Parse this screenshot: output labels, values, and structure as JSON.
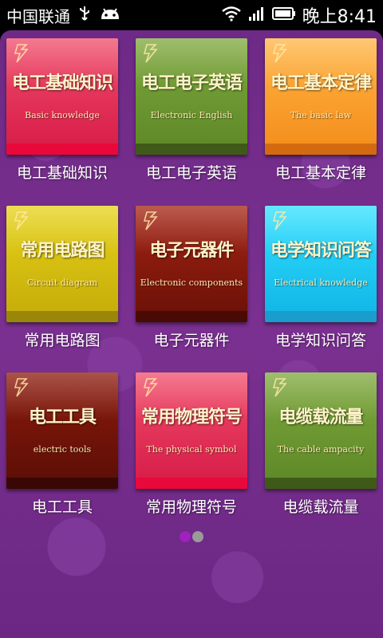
{
  "status_bar": {
    "carrier": "中国联通",
    "time": "晚上8:41",
    "icons": [
      "usb-icon",
      "android-icon",
      "wifi-icon",
      "signal-icon",
      "battery-icon"
    ]
  },
  "tiles": [
    {
      "title_zh": "电工基础知识",
      "title_en": "Basic knowledge",
      "caption": "电工基础知识",
      "color_top": "#f04d6b",
      "color_bottom": "#d81f4a",
      "base": "#e8083a"
    },
    {
      "title_zh": "电工电子英语",
      "title_en": "Electronic English",
      "caption": "电工电子英语",
      "color_top": "#7ea83d",
      "color_bottom": "#5f8a28",
      "base": "#3f5a18"
    },
    {
      "title_zh": "电工基本定律",
      "title_en": "The basic law",
      "caption": "电工基本定律",
      "color_top": "#ffb545",
      "color_bottom": "#f5901e",
      "base": "#d46a10"
    },
    {
      "title_zh": "常用电路图",
      "title_en": "Circuit diagram",
      "caption": "常用电路图",
      "color_top": "#e6d21a",
      "color_bottom": "#c7ae0a",
      "base": "#9a8608"
    },
    {
      "title_zh": "电子元器件",
      "title_en": "Electronic components",
      "caption": "电子元器件",
      "color_top": "#a52414",
      "color_bottom": "#6e1208",
      "base": "#4a0a04"
    },
    {
      "title_zh": "电学知识问答",
      "title_en": "Electrical knowledge",
      "caption": "电学知识问答",
      "color_top": "#33e0ff",
      "color_bottom": "#12b8e8",
      "base": "#1a9ccc"
    },
    {
      "title_zh": "电工工具",
      "title_en": "electric tools",
      "caption": "电工工具",
      "color_top": "#8e1a0c",
      "color_bottom": "#5e0f06",
      "base": "#3a0804"
    },
    {
      "title_zh": "常用物理符号",
      "title_en": "The physical symbol",
      "caption": "常用物理符号",
      "color_top": "#f04d6b",
      "color_bottom": "#d81f4a",
      "base": "#e8083a"
    },
    {
      "title_zh": "电缆载流量",
      "title_en": "The cable ampacity",
      "caption": "电缆载流量",
      "color_top": "#7ea83d",
      "color_bottom": "#5f8a28",
      "base": "#3f5a18"
    }
  ],
  "pager": {
    "count": 2,
    "active": 0,
    "active_color": "#a020c0",
    "inactive_color": "#9a9a9a"
  }
}
